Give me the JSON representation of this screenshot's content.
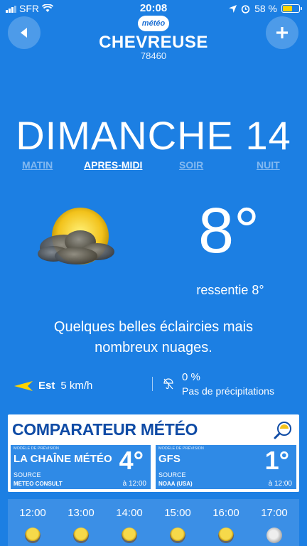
{
  "status": {
    "carrier": "SFR",
    "time": "20:08",
    "battery": "58 %",
    "battery_level": 0.58
  },
  "header": {
    "city": "CHEVREUSE",
    "zip": "78460",
    "logo_text": "météo",
    "back_icon": "back-icon",
    "add_icon": "plus-icon"
  },
  "day": "DIMANCHE 14",
  "periods": [
    {
      "label": "MATIN",
      "active": false
    },
    {
      "label": "APRES-MIDI",
      "active": true
    },
    {
      "label": "SOIR",
      "active": false
    },
    {
      "label": "NUIT",
      "active": false
    }
  ],
  "current": {
    "icon": "sun-with-cloud-icon",
    "temperature": "8°",
    "felt": "ressentie 8°",
    "description_line1": "Quelques belles éclaircies mais",
    "description_line2": "nombreux nuages."
  },
  "wind": {
    "direction": "Est",
    "speed": "5 km/h"
  },
  "precipitation": {
    "percent": "0 %",
    "label": "Pas de précipitations"
  },
  "comparator": {
    "title": "COMPARATEUR MÉTÉO",
    "cards": [
      {
        "label": "MODÈLE DE PRÉVISION",
        "name": "LA CHAÎNE MÉTÉO",
        "temp": "4°",
        "source_label": "SOURCE",
        "source": "METEO CONSULT",
        "time": "à 12:00"
      },
      {
        "label": "MODÈLE DE PRÉVISION",
        "name": "GFS",
        "temp": "1°",
        "source_label": "SOURCE",
        "source": "NOAA (USA)",
        "time": "à 12:00"
      }
    ]
  },
  "hourly": [
    {
      "time": "12:00",
      "icon": "sun-cloud-icon"
    },
    {
      "time": "13:00",
      "icon": "sun-cloud-icon"
    },
    {
      "time": "14:00",
      "icon": "sun-cloud-icon"
    },
    {
      "time": "15:00",
      "icon": "sun-cloud-icon"
    },
    {
      "time": "16:00",
      "icon": "sun-cloud-icon"
    },
    {
      "time": "17:00",
      "icon": "moon-icon"
    }
  ],
  "colors": {
    "background": "#1c7fe3",
    "comparator_title": "#0f4ba5",
    "card": "#2f8ae6",
    "sun": "#f2c21b"
  }
}
